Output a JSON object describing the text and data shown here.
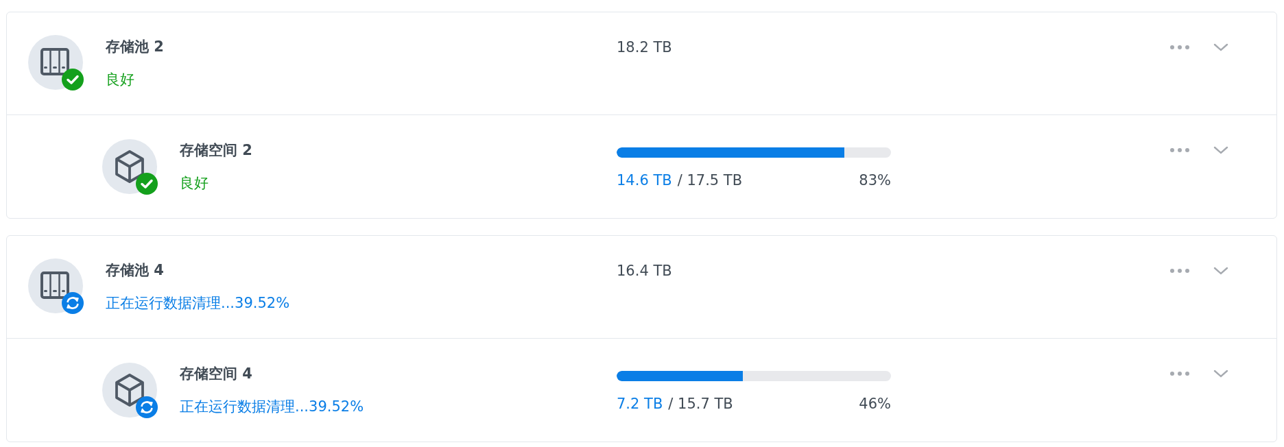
{
  "pools": [
    {
      "title": "存储池 2",
      "size": "18.2 TB",
      "status": {
        "kind": "ok",
        "text": "良好"
      },
      "volumes": [
        {
          "title": "存储空间 2",
          "status": {
            "kind": "ok",
            "text": "良好"
          },
          "used": "14.6 TB",
          "total": "/ 17.5 TB",
          "percent": "83%",
          "level": 0.83
        }
      ]
    },
    {
      "title": "存储池 4",
      "size": "16.4 TB",
      "status": {
        "kind": "scrubbing",
        "text": "正在运行数据清理...39.52%"
      },
      "volumes": [
        {
          "title": "存储空间 4",
          "status": {
            "kind": "scrubbing",
            "text": "正在运行数据清理...39.52%"
          },
          "used": "7.2 TB",
          "total": "/ 15.7 TB",
          "percent": "46%",
          "level": 0.46
        }
      ]
    }
  ]
}
